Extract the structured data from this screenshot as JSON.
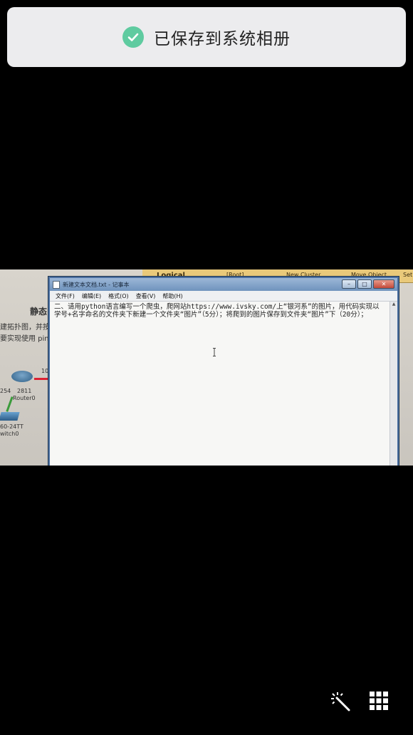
{
  "toast": {
    "message": "已保存到系统相册",
    "icon": "check-circle-icon",
    "accent": "#5fcba0"
  },
  "photo": {
    "background_app": {
      "toolbar": [
        "Logical",
        "[Root]",
        "New Cluster",
        "Move Object",
        "Set"
      ],
      "left_texts": [
        "静态",
        "建拓扑图，并按",
        "要实现使用 pin",
        "10.",
        "254",
        "2811",
        "Router0",
        "60-24TT",
        "witch0"
      ]
    },
    "notepad": {
      "title": "新建文本文档.txt - 记事本",
      "menu": [
        "文件(F)",
        "编辑(E)",
        "格式(O)",
        "查看(V)",
        "帮助(H)"
      ],
      "content": "二、请用python语言编写一个爬虫，爬网站https://www.ivsky.com/上“银河系”的图片，用代码实现以学号+名字命名的文件夹下新建一个文件夹“图片”（5分）；将爬到的图片保存到文件夹“图片”下（20分）；",
      "buttons": {
        "minimize": "–",
        "maximize": "□",
        "close": "✕"
      }
    }
  },
  "bottom_bar": {
    "left_icon": "magic-wand-icon",
    "right_icon": "grid-icon"
  }
}
